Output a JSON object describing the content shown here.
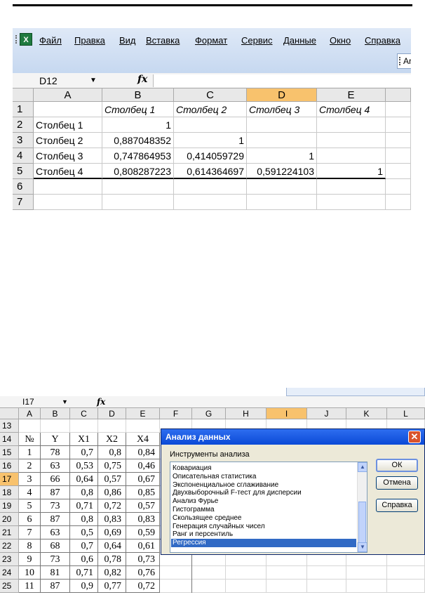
{
  "shot1": {
    "menu": [
      "Файл",
      "Правка",
      "Вид",
      "Вставка",
      "Формат",
      "Сервис",
      "Данные",
      "Окно",
      "Справка"
    ],
    "toolbar_partial": "Ar",
    "name_box": "D12",
    "fx": "fx",
    "columns": [
      "A",
      "B",
      "C",
      "D",
      "E"
    ],
    "selected_column": "D",
    "rows": [
      {
        "n": "1",
        "cells": [
          "",
          "Столбец 1",
          "Столбец 2",
          "Столбец 3",
          "Столбец 4"
        ]
      },
      {
        "n": "2",
        "cells": [
          "Столбец 1",
          "1",
          "",
          "",
          ""
        ]
      },
      {
        "n": "3",
        "cells": [
          "Столбец 2",
          "0,887048352",
          "1",
          "",
          ""
        ]
      },
      {
        "n": "4",
        "cells": [
          "Столбец 3",
          "0,747864953",
          "0,414059729",
          "1",
          ""
        ]
      },
      {
        "n": "5",
        "cells": [
          "Столбец 4",
          "0,808287223",
          "0,614364697",
          "0,591224103",
          "1"
        ]
      },
      {
        "n": "6",
        "cells": [
          "",
          "",
          "",
          "",
          ""
        ]
      },
      {
        "n": "7",
        "cells": [
          "",
          "",
          "",
          "",
          ""
        ]
      }
    ]
  },
  "shot2": {
    "name_box": "I17",
    "fx": "fx",
    "columns": [
      "A",
      "B",
      "C",
      "D",
      "E",
      "F",
      "G",
      "H",
      "I",
      "J",
      "K",
      "L"
    ],
    "selected_column": "I",
    "selected_row": "17",
    "row_numbers": [
      "13",
      "14",
      "15",
      "16",
      "17",
      "18",
      "19",
      "20",
      "21",
      "22",
      "23",
      "24",
      "25"
    ],
    "table_header": [
      "№",
      "Y",
      "X1",
      "X2",
      "X4"
    ],
    "table_rows": [
      [
        "1",
        "78",
        "0,7",
        "0,8",
        "0,84"
      ],
      [
        "2",
        "63",
        "0,53",
        "0,75",
        "0,46"
      ],
      [
        "3",
        "66",
        "0,64",
        "0,57",
        "0,67"
      ],
      [
        "4",
        "87",
        "0,8",
        "0,86",
        "0,85"
      ],
      [
        "5",
        "73",
        "0,71",
        "0,72",
        "0,57"
      ],
      [
        "6",
        "87",
        "0,8",
        "0,83",
        "0,83"
      ],
      [
        "7",
        "63",
        "0,5",
        "0,69",
        "0,59"
      ],
      [
        "8",
        "68",
        "0,7",
        "0,64",
        "0,61"
      ],
      [
        "9",
        "73",
        "0,6",
        "0,78",
        "0,73"
      ],
      [
        "10",
        "81",
        "0,71",
        "0,82",
        "0,76"
      ],
      [
        "11",
        "87",
        "0,9",
        "0,77",
        "0,72"
      ]
    ],
    "dialog": {
      "title": "Анализ данных",
      "label": "Инструменты анализа",
      "items": [
        "Ковариация",
        "Описательная статистика",
        "Экспоненциальное сглаживание",
        "Двухвыборочный F-тест для дисперсии",
        "Анализ Фурье",
        "Гистограмма",
        "Скользящее среднее",
        "Генерация случайных чисел",
        "Ранг и персентиль",
        "Регрессия"
      ],
      "selected_index": 9,
      "ok": "ОК",
      "cancel": "Отмена",
      "help": "Справка"
    }
  }
}
